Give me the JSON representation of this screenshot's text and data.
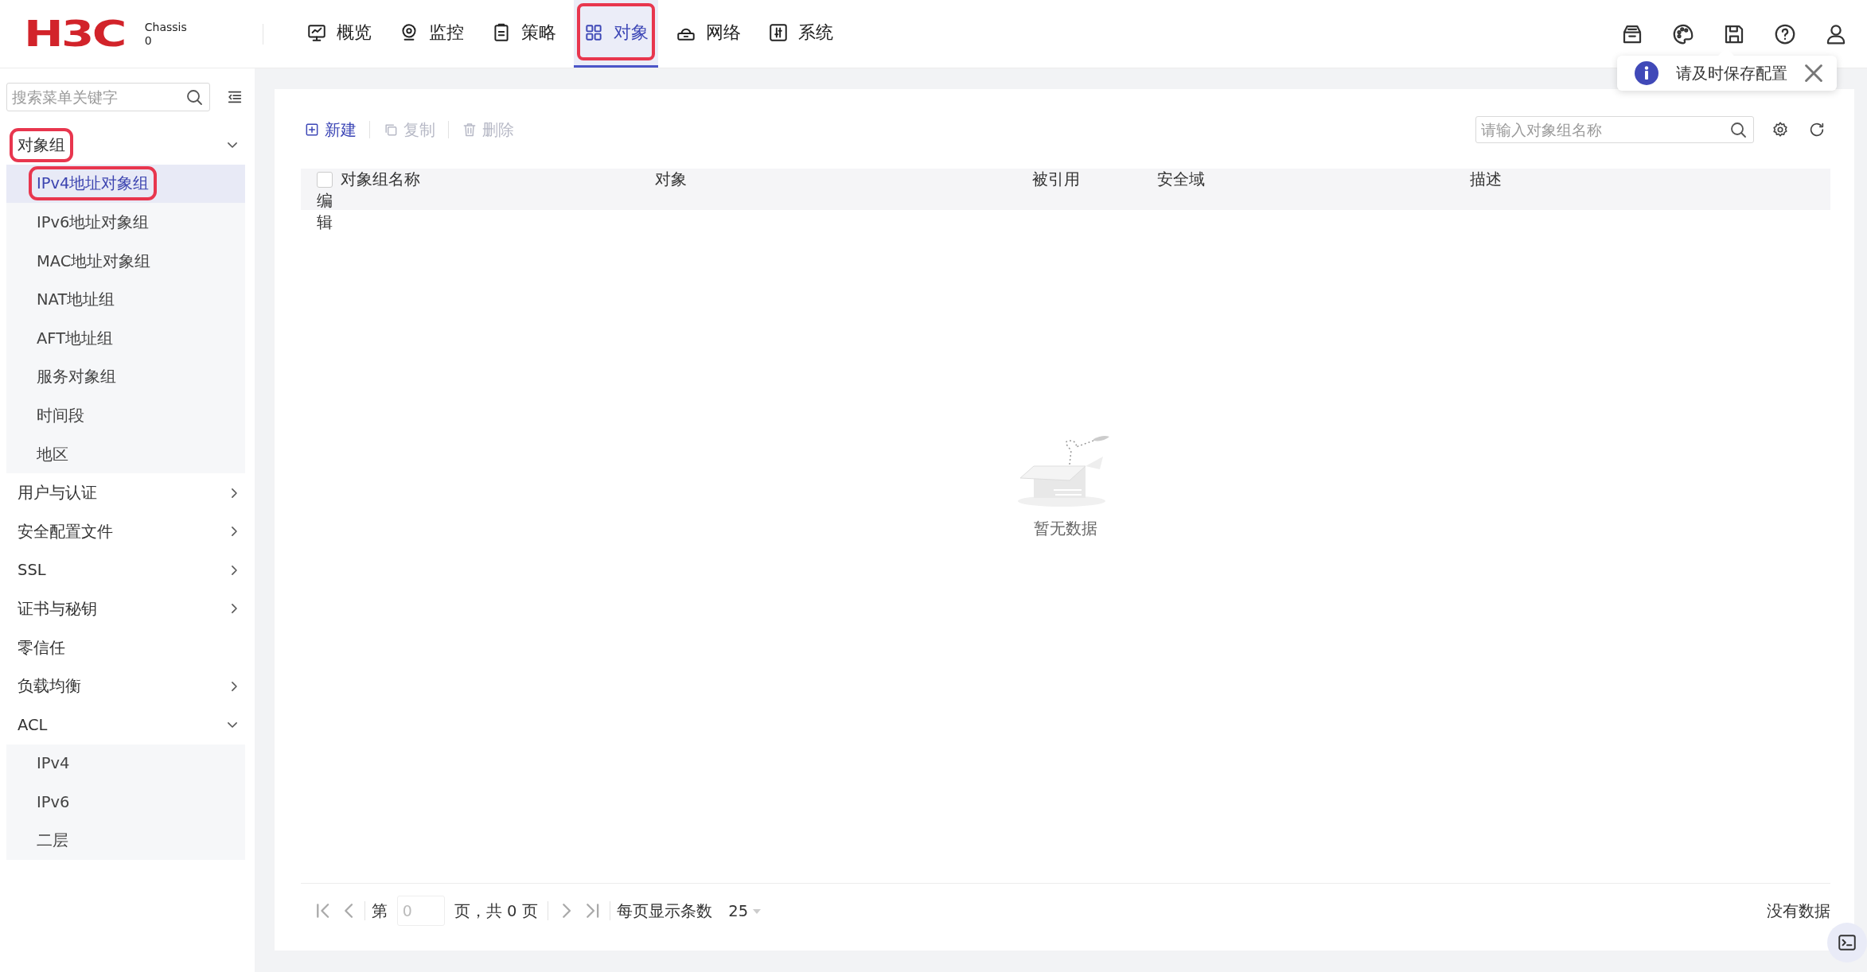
{
  "header": {
    "logo": "H3C",
    "device_label": "Chassis",
    "device_value": "0",
    "tabs": [
      {
        "label": "概览",
        "selected": false,
        "annotated": false
      },
      {
        "label": "监控",
        "selected": false,
        "annotated": false
      },
      {
        "label": "策略",
        "selected": false,
        "annotated": false
      },
      {
        "label": "对象",
        "selected": true,
        "annotated": true
      },
      {
        "label": "网络",
        "selected": false,
        "annotated": false
      },
      {
        "label": "系统",
        "selected": false,
        "annotated": false
      }
    ],
    "toast": {
      "text": "请及时保存配置"
    }
  },
  "sidebar": {
    "search": {
      "placeholder": "搜索菜单关键字"
    },
    "items": [
      {
        "label": "对象组",
        "kind": "folder",
        "expanded": true,
        "annotated": true,
        "children": [
          {
            "label": "IPv4地址对象组",
            "selected": true,
            "annotated": true
          },
          {
            "label": "IPv6地址对象组",
            "selected": false,
            "annotated": false
          },
          {
            "label": "MAC地址对象组",
            "selected": false,
            "annotated": false
          },
          {
            "label": "NAT地址组",
            "selected": false,
            "annotated": false
          },
          {
            "label": "AFT地址组",
            "selected": false,
            "annotated": false
          },
          {
            "label": "服务对象组",
            "selected": false,
            "annotated": false
          },
          {
            "label": "时间段",
            "selected": false,
            "annotated": false
          },
          {
            "label": "地区",
            "selected": false,
            "annotated": false
          }
        ]
      },
      {
        "label": "用户与认证",
        "kind": "folder",
        "expanded": false,
        "annotated": false
      },
      {
        "label": "安全配置文件",
        "kind": "folder",
        "expanded": false,
        "annotated": false
      },
      {
        "label": "SSL",
        "kind": "folder",
        "expanded": false,
        "annotated": false
      },
      {
        "label": "证书与秘钥",
        "kind": "folder",
        "expanded": false,
        "annotated": false
      },
      {
        "label": "零信任",
        "kind": "leaf",
        "annotated": false
      },
      {
        "label": "负载均衡",
        "kind": "folder",
        "expanded": false,
        "annotated": false
      },
      {
        "label": "ACL",
        "kind": "folder",
        "expanded": true,
        "annotated": false,
        "children": [
          {
            "label": "IPv4",
            "selected": false,
            "annotated": false
          },
          {
            "label": "IPv6",
            "selected": false,
            "annotated": false
          },
          {
            "label": "二层",
            "selected": false,
            "annotated": false
          }
        ]
      }
    ]
  },
  "toolbar": {
    "actions": [
      {
        "label": "新建",
        "disabled": false
      },
      {
        "label": "复制",
        "disabled": true
      },
      {
        "label": "删除",
        "disabled": true
      }
    ],
    "search": {
      "placeholder": "请输入对象组名称"
    }
  },
  "table": {
    "select_all": {
      "checked": false
    },
    "columns": [
      "对象组名称",
      "对象",
      "被引用",
      "安全域",
      "描述",
      "编辑"
    ],
    "empty_text": "暂无数据"
  },
  "pagination": {
    "page_prefix": "第",
    "page_input": {
      "placeholder": "0"
    },
    "page_suffix": "页，共 0 页",
    "page_size_label": "每页显示条数",
    "page_size": "25",
    "summary": "没有数据"
  }
}
